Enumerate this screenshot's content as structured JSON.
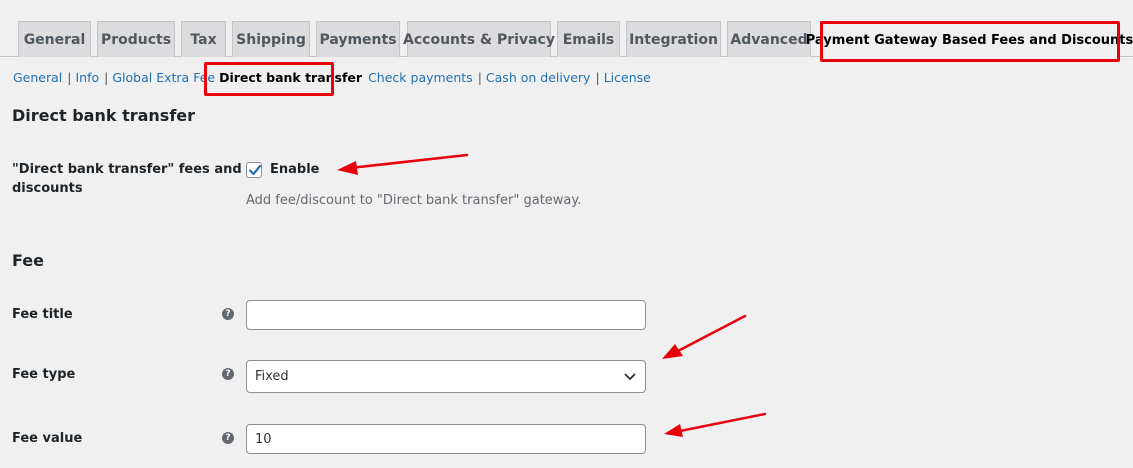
{
  "tabs": [
    {
      "label": "General"
    },
    {
      "label": "Products"
    },
    {
      "label": "Tax"
    },
    {
      "label": "Shipping"
    },
    {
      "label": "Payments"
    },
    {
      "label": "Accounts & Privacy"
    },
    {
      "label": "Emails"
    },
    {
      "label": "Integration"
    },
    {
      "label": "Advanced"
    },
    {
      "label": "Payment Gateway Based Fees and Discounts"
    }
  ],
  "subnav": {
    "general": "General",
    "info": "Info",
    "global_extra_fee": "Global Extra Fee",
    "direct_bank_transfer": "Direct bank transfer",
    "check_payments": "Check payments",
    "cash_on_delivery": "Cash on delivery",
    "license": "License",
    "separator": "|"
  },
  "section_title": "Direct bank transfer",
  "enable_row": {
    "label_line1": "\"Direct bank transfer\" fees and",
    "label_line2": "discounts",
    "checkbox_label": "Enable",
    "checked": true,
    "description": "Add fee/discount to \"Direct bank transfer\" gateway."
  },
  "fee_section_title": "Fee",
  "fields": {
    "fee_title": {
      "label": "Fee title",
      "value": ""
    },
    "fee_type": {
      "label": "Fee type",
      "value": "Fixed"
    },
    "fee_value": {
      "label": "Fee value",
      "value": "10"
    }
  },
  "help_glyph": "?",
  "colors": {
    "accent": "#2271b1",
    "highlight": "#e8000b",
    "check": "#2271b1"
  }
}
